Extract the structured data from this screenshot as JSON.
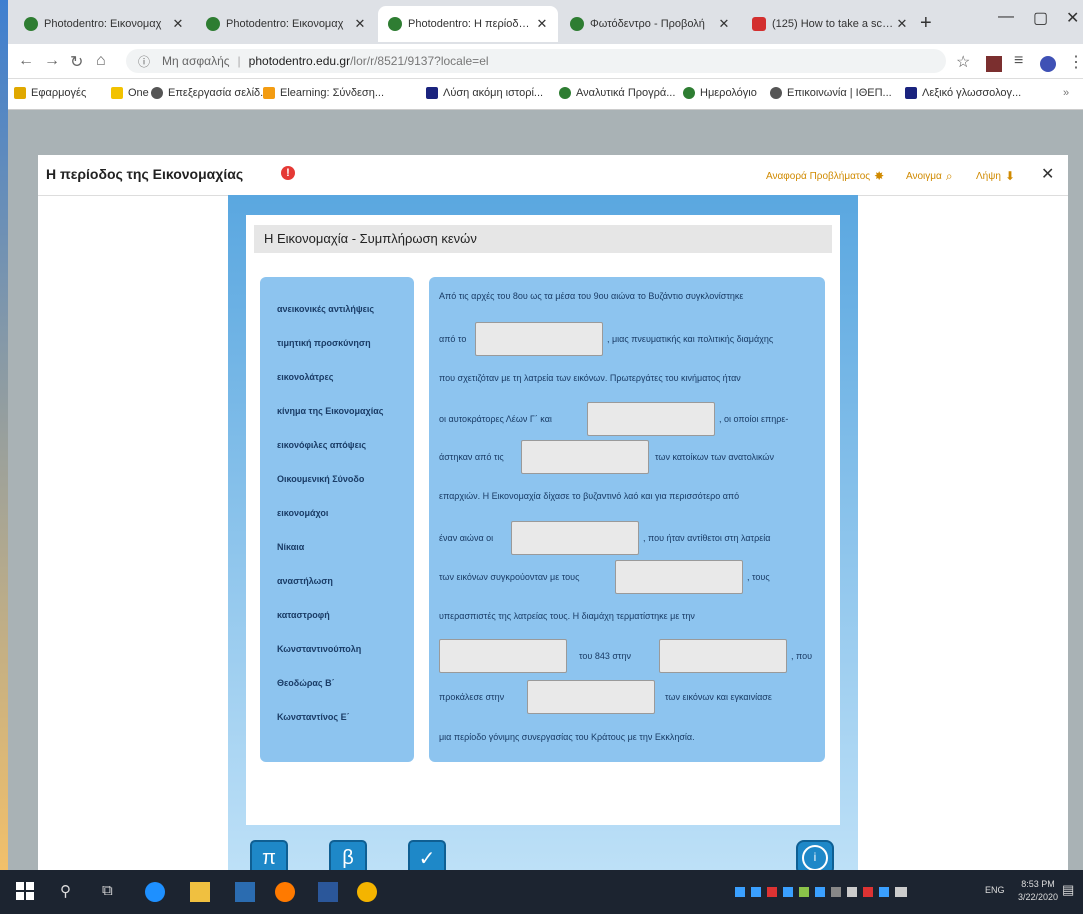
{
  "browser": {
    "tabs": [
      {
        "title": "Photodentro: Εικονομαχ"
      },
      {
        "title": "Photodentro: Εικονομαχ"
      },
      {
        "title": "Photodentro: Η περίοδος τ"
      },
      {
        "title": "Φωτόδεντρο - Προβολή"
      },
      {
        "title": "(125) How to take a scree"
      }
    ],
    "address": {
      "security": "Μη ασφαλής",
      "host": "photodentro.edu.gr",
      "path": "/lor/r/8521/9137?locale=el"
    },
    "bookmarks": [
      {
        "label": "Εφαρμογές",
        "color": "#e0a800"
      },
      {
        "label": "One",
        "color": "#f2c200"
      },
      {
        "label": "Επεξεργασία σελίδ...",
        "color": "#555"
      },
      {
        "label": "Elearning: Σύνδεση...",
        "color": "#f39c12"
      },
      {
        "label": "Λύση ακόμη ιστορί...",
        "color": "#1a237e"
      },
      {
        "label": "Αναλυτικά Προγρά...",
        "color": "#2e7d32"
      },
      {
        "label": "Ημερολόγιο",
        "color": "#2e7d32"
      },
      {
        "label": "Επικοινωνία | ΙΘΕΠ...",
        "color": "#555"
      },
      {
        "label": "Λεξικό γλωσσολογ...",
        "color": "#1a237e"
      }
    ]
  },
  "modal": {
    "title": "Η περίοδος της Εικονομαχίας",
    "report_label": "Αναφορά Προβλήματος",
    "share_label": "Ανοιγμα",
    "download_label": "Λήψη"
  },
  "activity": {
    "title": "Η Εικονομαχία - Συμπλήρωση κενών",
    "word_bank": [
      "ανεικονικές αντιλήψεις",
      "τιμητική προσκύνηση",
      "εικονολάτρες",
      "κίνημα της Εικονομαχίας",
      "εικονόφιλες απόψεις",
      "Οικουμενική Σύνοδο",
      "εικονομάχοι",
      "Νίκαια",
      "αναστήλωση",
      "καταστροφή",
      "Κωνσταντινούπολη",
      "Θεοδώρας Β΄",
      "Κωνσταντίνος Ε΄"
    ],
    "text": {
      "l1": "Από τις αρχές του 8ου ως τα μέσα του 9ου αιώνα το Βυζάντιο συγκλονίστηκε",
      "l2a": "από το",
      "l2b": ", μιας πνευματικής και πολιτικής διαμάχης",
      "l3": "που σχετιζόταν με τη λατρεία των εικόνων. Πρωτεργάτες του κινήματος ήταν",
      "l4a": "οι αυτοκράτορες Λέων Γ΄ και",
      "l4b": ", οι οποίοι επηρε-",
      "l5a": "άστηκαν από τις",
      "l5b": "των κατοίκων των ανατολικών",
      "l6": "επαρχιών. Η Εικονομαχία δίχασε το βυζαντινό λαό και για περισσότερο από",
      "l7a": "έναν αιώνα οι",
      "l7b": ", που ήταν αντίθετοι στη λατρεία",
      "l8a": "των εικόνων συγκρούονταν με τους",
      "l8b": ", τους",
      "l9": "υπερασπιστές της λατρείας τους. Η διαμάχη τερματίστηκε με την",
      "l10a": "του 843 στην",
      "l10b": ", που",
      "l11a": "προκάλεσε στην",
      "l11b": "των εικόνων και εγκαινίασε",
      "l12": "μια περίοδο γόνιμης συνεργασίας του Κράτους με την Εκκλησία."
    },
    "buttons": {
      "restart": "π",
      "back": "β",
      "check": "✓",
      "info": "i"
    }
  },
  "taskbar": {
    "time": "8:53 PM",
    "date": "3/22/2020",
    "lang": "ENG"
  }
}
